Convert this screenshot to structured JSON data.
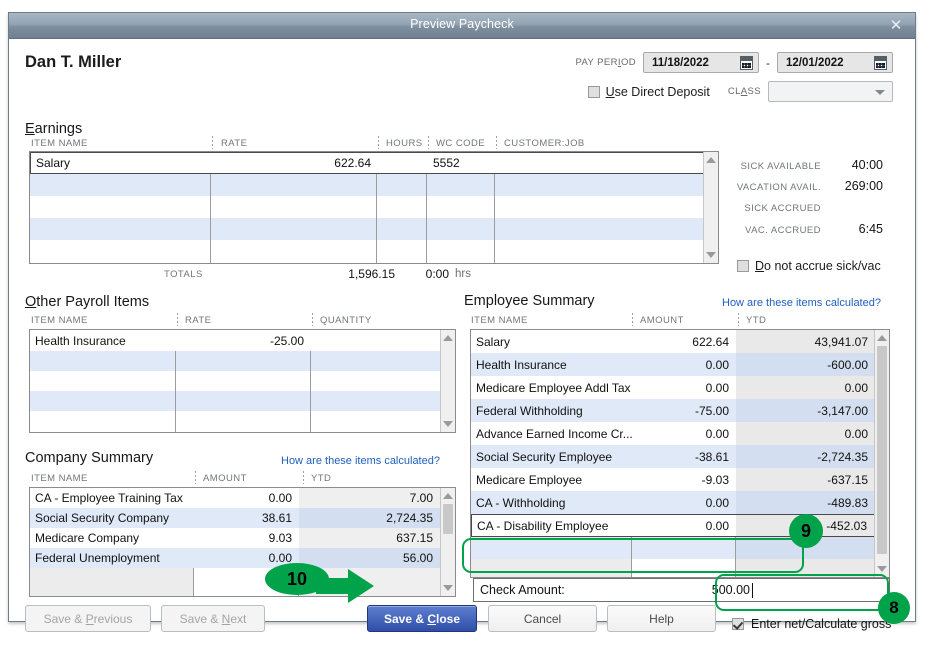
{
  "window": {
    "title": "Preview Paycheck",
    "close_icon": "close-icon"
  },
  "header": {
    "employee_name": "Dan T. Miller",
    "pay_period_label": "PAY PERIOD",
    "pay_period_start": "11/18/2022",
    "pay_period_end": "12/01/2022",
    "date_separator": "-",
    "use_direct_deposit_label": "Use Direct Deposit",
    "use_direct_deposit_checked": false,
    "class_label": "CLASS",
    "class_value": ""
  },
  "earnings": {
    "title": "Earnings",
    "columns": [
      "ITEM NAME",
      "RATE",
      "HOURS",
      "WC CODE",
      "CUSTOMER:JOB"
    ],
    "rows": [
      {
        "item": "Salary",
        "rate": "622.64",
        "hours": "",
        "wc_code": "5552",
        "customer_job": ""
      }
    ],
    "totals_label": "TOTALS",
    "totals_rate": "1,596.15",
    "totals_hours": "0:00",
    "totals_hours_suffix": "hrs"
  },
  "stats": {
    "items": [
      {
        "label": "SICK AVAILABLE",
        "value": "40:00"
      },
      {
        "label": "VACATION AVAIL.",
        "value": "269:00"
      },
      {
        "label": "SICK ACCRUED",
        "value": ""
      },
      {
        "label": "VAC. ACCRUED",
        "value": "6:45"
      }
    ],
    "do_not_accrue_label": "Do not accrue sick/vac",
    "do_not_accrue_checked": false
  },
  "other_payroll_items": {
    "title": "Other Payroll Items",
    "columns": [
      "ITEM NAME",
      "RATE",
      "QUANTITY"
    ],
    "rows": [
      {
        "item": "Health Insurance",
        "rate": "-25.00",
        "quantity": ""
      }
    ]
  },
  "company_summary": {
    "title": "Company Summary",
    "how_link": "How are these items calculated?",
    "columns": [
      "ITEM NAME",
      "AMOUNT",
      "YTD"
    ],
    "rows": [
      {
        "item": "CA - Employee Training Tax",
        "amount": "0.00",
        "ytd": "7.00"
      },
      {
        "item": "Social Security Company",
        "amount": "38.61",
        "ytd": "2,724.35"
      },
      {
        "item": "Medicare Company",
        "amount": "9.03",
        "ytd": "637.15"
      },
      {
        "item": "Federal Unemployment",
        "amount": "0.00",
        "ytd": "56.00"
      }
    ]
  },
  "employee_summary": {
    "title": "Employee Summary",
    "how_link": "How are these items calculated?",
    "columns": [
      "ITEM NAME",
      "AMOUNT",
      "YTD"
    ],
    "rows": [
      {
        "item": "Salary",
        "amount": "622.64",
        "ytd": "43,941.07"
      },
      {
        "item": "Health Insurance",
        "amount": "0.00",
        "ytd": "-600.00"
      },
      {
        "item": "Medicare Employee Addl Tax",
        "amount": "0.00",
        "ytd": "0.00"
      },
      {
        "item": "Federal Withholding",
        "amount": "-75.00",
        "ytd": "-3,147.00"
      },
      {
        "item": "Advance Earned Income Cr...",
        "amount": "0.00",
        "ytd": "0.00"
      },
      {
        "item": "Social Security Employee",
        "amount": "-38.61",
        "ytd": "-2,724.35"
      },
      {
        "item": "Medicare Employee",
        "amount": "-9.03",
        "ytd": "-637.15"
      },
      {
        "item": "CA - Withholding",
        "amount": "0.00",
        "ytd": "-489.83"
      },
      {
        "item": "CA - Disability Employee",
        "amount": "0.00",
        "ytd": "-452.03"
      }
    ]
  },
  "check_amount": {
    "label": "Check Amount:",
    "value": "500.00"
  },
  "footer": {
    "save_previous": "Save & Previous",
    "save_next": "Save & Next",
    "save_close": "Save & Close",
    "cancel": "Cancel",
    "help": "Help",
    "enter_net_label": "Enter net/Calculate gross",
    "enter_net_checked": true
  },
  "annotations": {
    "step8": "8",
    "step9": "9",
    "step10": "10",
    "accent_color": "#00a24a"
  }
}
